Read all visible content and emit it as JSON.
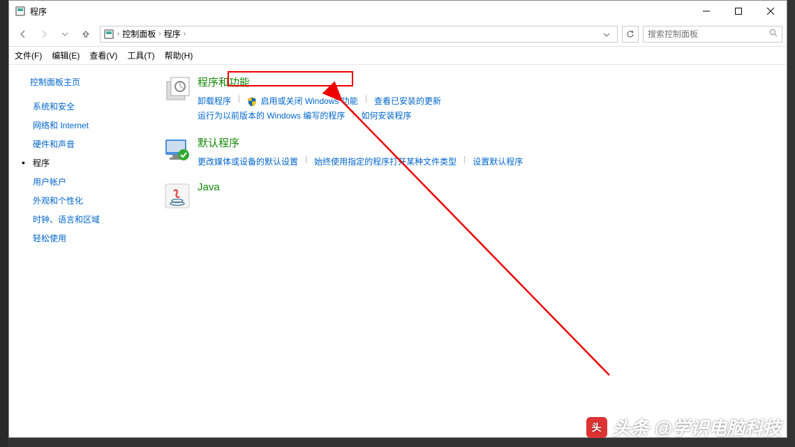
{
  "window": {
    "title": "程序"
  },
  "breadcrumbs": {
    "items": [
      "控制面板",
      "程序"
    ]
  },
  "search": {
    "placeholder": "搜索控制面板"
  },
  "menu": [
    "文件(F)",
    "编辑(E)",
    "查看(V)",
    "工具(T)",
    "帮助(H)"
  ],
  "sidebar": {
    "home": "控制面板主页",
    "items": [
      {
        "label": "系统和安全",
        "active": false
      },
      {
        "label": "网络和 Internet",
        "active": false
      },
      {
        "label": "硬件和声音",
        "active": false
      },
      {
        "label": "程序",
        "active": true
      },
      {
        "label": "用户帐户",
        "active": false
      },
      {
        "label": "外观和个性化",
        "active": false
      },
      {
        "label": "时钟、语言和区域",
        "active": false
      },
      {
        "label": "轻松使用",
        "active": false
      }
    ]
  },
  "groups": [
    {
      "title": "程序和功能",
      "links": [
        {
          "label": "卸载程序",
          "shield": false
        },
        {
          "label": "启用或关闭 Windows 功能",
          "shield": true,
          "highlighted": true
        },
        {
          "label": "查看已安装的更新",
          "shield": false
        },
        {
          "label": "运行为以前版本的 Windows 编写的程序",
          "shield": false
        },
        {
          "label": "如何安装程序",
          "shield": false
        }
      ]
    },
    {
      "title": "默认程序",
      "links": [
        {
          "label": "更改媒体或设备的默认设置",
          "shield": false
        },
        {
          "label": "始终使用指定的程序打开某种文件类型",
          "shield": false
        },
        {
          "label": "设置默认程序",
          "shield": false
        }
      ]
    },
    {
      "title": "Java",
      "links": []
    }
  ],
  "watermark": {
    "prefix": "头条",
    "handle": "@学识电脑科技"
  }
}
